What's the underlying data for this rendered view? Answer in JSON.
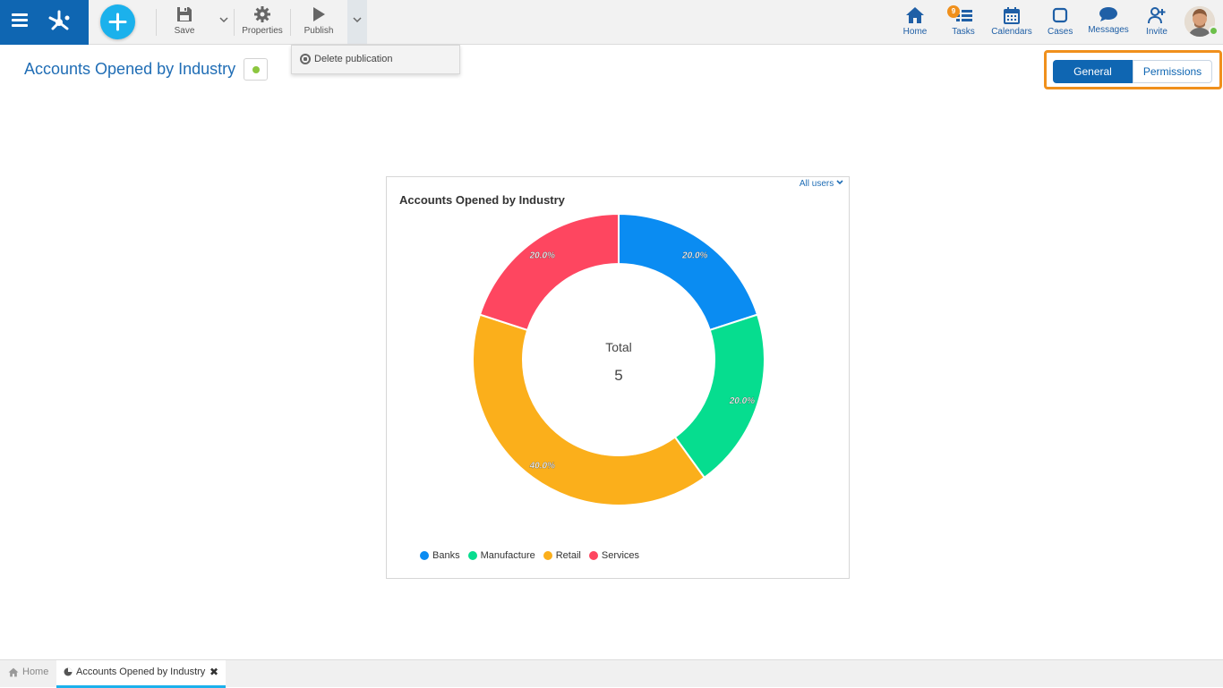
{
  "toolbar": {
    "save_label": "Save",
    "properties_label": "Properties",
    "publish_label": "Publish"
  },
  "publish_menu": {
    "items": [
      {
        "label": "Delete publication",
        "icon": "stop-circle-icon"
      }
    ]
  },
  "nav": {
    "home": "Home",
    "tasks": "Tasks",
    "tasks_badge": "9",
    "calendars": "Calendars",
    "cases": "Cases",
    "messages": "Messages",
    "invite": "Invite"
  },
  "page": {
    "title": "Accounts Opened by Industry",
    "status_color": "#8cc63f"
  },
  "tabs": {
    "general": "General",
    "permissions": "Permissions",
    "active": "General"
  },
  "chart": {
    "filter_label": "All users",
    "center_label": "Total",
    "center_value": "5"
  },
  "chart_data": {
    "type": "pie",
    "title": "Accounts Opened by Industry",
    "categories": [
      "Banks",
      "Manufacture",
      "Retail",
      "Services"
    ],
    "values": [
      1,
      1,
      2,
      1
    ],
    "percent_labels": [
      "20.0%",
      "20.0%",
      "40.0%",
      "20.0%"
    ],
    "colors": [
      "#0a8cf2",
      "#06dd8f",
      "#fbaf1b",
      "#fe4660"
    ],
    "donut": true,
    "legend_position": "bottom"
  },
  "bottom_tabs": {
    "home": "Home",
    "active": "Accounts Opened by Industry"
  },
  "colors": {
    "brand": "#0f66b2",
    "accent": "#1bb1ec",
    "highlight": "#f0901c"
  }
}
